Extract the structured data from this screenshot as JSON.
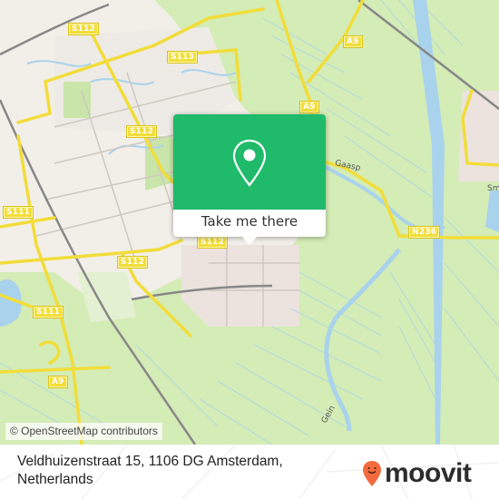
{
  "map": {
    "road_shields": [
      {
        "label": "S112"
      },
      {
        "label": "S113"
      },
      {
        "label": "S112"
      },
      {
        "label": "S111"
      },
      {
        "label": "S112"
      },
      {
        "label": "S112"
      },
      {
        "label": "S111"
      },
      {
        "label": "A9"
      },
      {
        "label": "A9"
      },
      {
        "label": "A9"
      },
      {
        "label": "N236"
      }
    ],
    "place_labels": [
      {
        "label": "Gaasp"
      },
      {
        "label": "Sm"
      },
      {
        "label": "Gein"
      }
    ],
    "attribution": "© OpenStreetMap contributors"
  },
  "popup": {
    "icon": "map-pin-icon",
    "button_label": "Take me there",
    "accent_color": "#1fba6a"
  },
  "footer": {
    "address_line1": "Veldhuizenstraat 15, 1106 DG Amsterdam,",
    "address_line2": "Netherlands",
    "brand": "moovit",
    "brand_color": "#f26a3d"
  }
}
